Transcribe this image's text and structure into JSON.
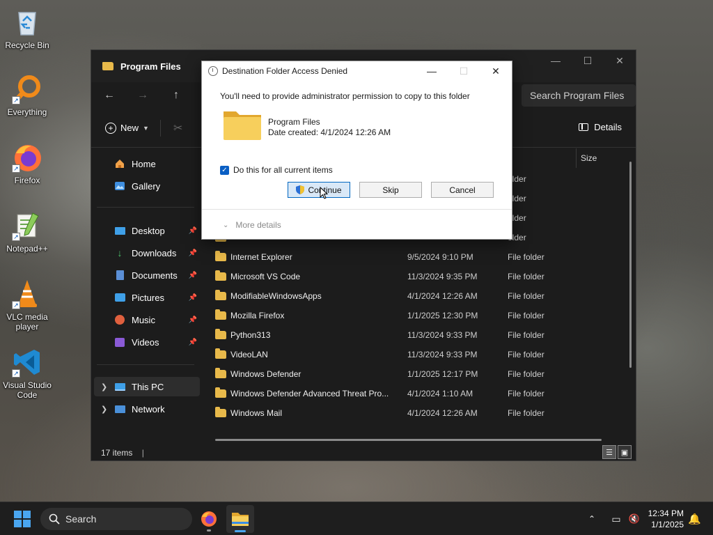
{
  "desktop": {
    "icons": [
      {
        "label": "Recycle Bin",
        "icon": "recycle-bin-icon"
      },
      {
        "label": "Everything",
        "icon": "everything-search-icon"
      },
      {
        "label": "Firefox",
        "icon": "firefox-icon"
      },
      {
        "label": "Notepad++",
        "icon": "notepad-plus-plus-icon"
      },
      {
        "label": "VLC media player",
        "icon": "vlc-icon"
      },
      {
        "label": "Visual Studio Code",
        "icon": "vscode-icon"
      }
    ]
  },
  "explorer": {
    "tab_title": "Program Files",
    "search_placeholder": "Search Program Files",
    "toolbar": {
      "new_label": "New",
      "details_label": "Details"
    },
    "sidebar": {
      "home": "Home",
      "gallery": "Gallery",
      "quick": [
        "Desktop",
        "Downloads",
        "Documents",
        "Pictures",
        "Music",
        "Videos"
      ],
      "this_pc": "This PC",
      "network": "Network"
    },
    "columns": {
      "size": "Size"
    },
    "partial_type": "older",
    "files": [
      {
        "name": "Internet Explorer",
        "date": "9/5/2024 9:10 PM",
        "type": "File folder"
      },
      {
        "name": "Microsoft VS Code",
        "date": "11/3/2024 9:35 PM",
        "type": "File folder"
      },
      {
        "name": "ModifiableWindowsApps",
        "date": "4/1/2024 12:26 AM",
        "type": "File folder"
      },
      {
        "name": "Mozilla Firefox",
        "date": "1/1/2025 12:30 PM",
        "type": "File folder"
      },
      {
        "name": "Python313",
        "date": "11/3/2024 9:33 PM",
        "type": "File folder"
      },
      {
        "name": "VideoLAN",
        "date": "11/3/2024 9:33 PM",
        "type": "File folder"
      },
      {
        "name": "Windows Defender",
        "date": "1/1/2025 12:17 PM",
        "type": "File folder"
      },
      {
        "name": "Windows Defender Advanced Threat Pro...",
        "date": "4/1/2024 1:10 AM",
        "type": "File folder"
      },
      {
        "name": "Windows Mail",
        "date": "4/1/2024 12:26 AM",
        "type": "File folder"
      }
    ],
    "status": "17 items"
  },
  "dialog": {
    "title": "Destination Folder Access Denied",
    "message": "You'll need to provide administrator permission to copy to this folder",
    "folder_name": "Program Files",
    "folder_date": "Date created: 4/1/2024 12:26 AM",
    "checkbox_label": "Do this for all current items",
    "checkbox_checked": true,
    "buttons": {
      "continue": "Continue",
      "skip": "Skip",
      "cancel": "Cancel"
    },
    "more_details": "More details"
  },
  "taskbar": {
    "search_label": "Search",
    "time": "12:34 PM",
    "date": "1/1/2025"
  },
  "colors": {
    "accent": "#0067c0",
    "folder": "#e8b94a",
    "start": "#4aa6f0"
  }
}
